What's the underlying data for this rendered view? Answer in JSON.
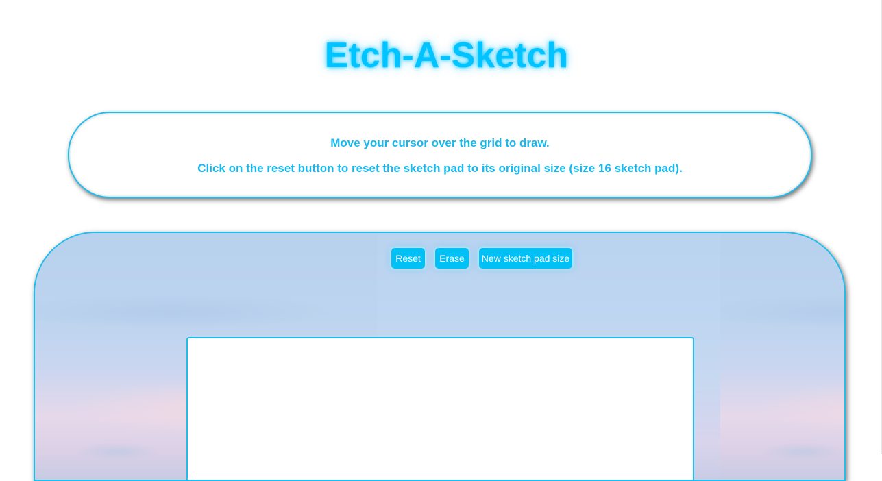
{
  "header": {
    "title": "Etch-A-Sketch"
  },
  "instructions": {
    "line1": "Move your cursor over the grid to draw.",
    "line2": "Click on the reset button to reset the sketch pad to its original size (size 16 sketch pad)."
  },
  "controls": {
    "reset_label": "Reset",
    "erase_label": "Erase",
    "new_size_label": "New sketch pad size"
  },
  "colors": {
    "accent": "#00c3ff",
    "border": "#1fbdeb",
    "button": "#00c0f6"
  }
}
